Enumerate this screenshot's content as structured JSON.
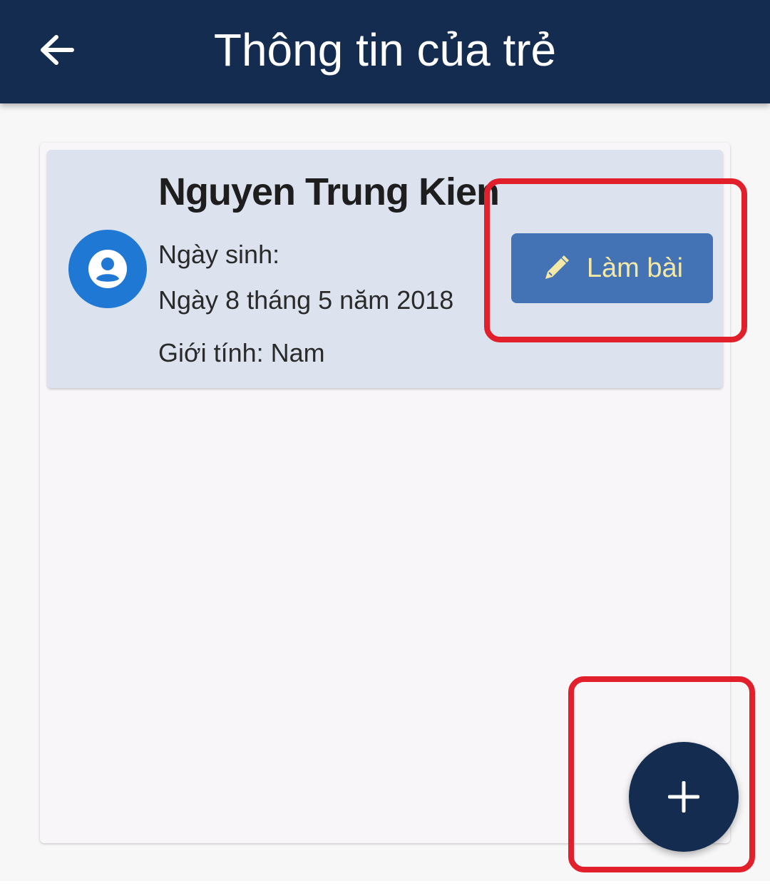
{
  "app_bar": {
    "title": "Thông tin của trẻ",
    "back_icon": "arrow-left-icon",
    "background_color": "#132c4f"
  },
  "child": {
    "name": "Nguyen Trung Kien",
    "dob_label": "Ngày sinh:",
    "dob_value": "Ngày 8 tháng 5 năm 2018",
    "gender": "Giới tính: Nam",
    "avatar_icon": "account-circle-icon"
  },
  "actions": {
    "do_test_label": "Làm bài",
    "do_test_icon": "pencil-icon",
    "add_icon": "plus-icon"
  },
  "colors": {
    "accent": "#4373b4",
    "button_text": "#f4e8a6",
    "avatar": "#1f78d4",
    "highlight": "#e2202c"
  }
}
